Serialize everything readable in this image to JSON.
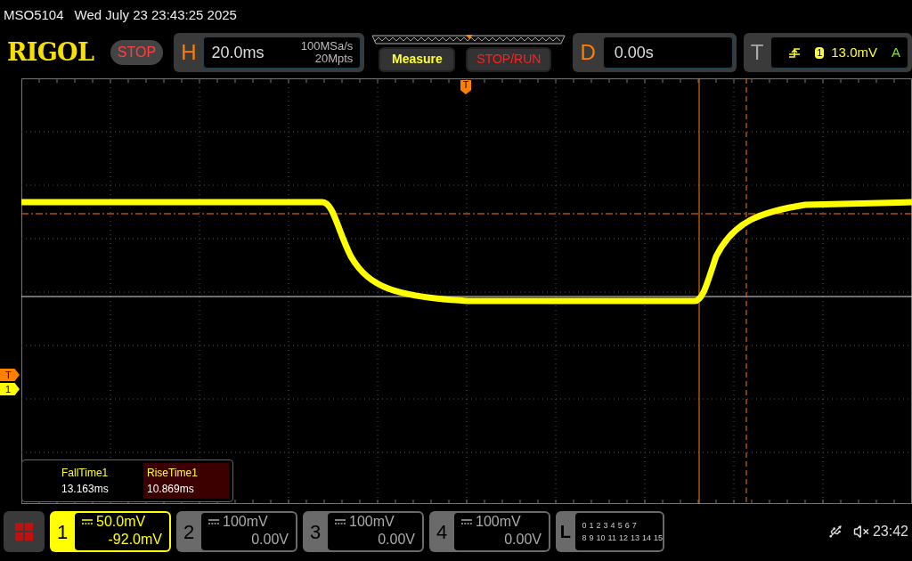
{
  "status_line": {
    "model": "MSO5104",
    "datetime": "Wed July 23 23:43:25 2025"
  },
  "header": {
    "logo": "RIGOL",
    "run_state": "STOP",
    "horizontal": {
      "label": "H",
      "timebase": "20.0ms",
      "sample_rate": "100MSa/s",
      "memory_depth": "20Mpts"
    },
    "buttons": [
      {
        "label": "Measure",
        "kind": "measure"
      },
      {
        "label": "STOP/RUN",
        "kind": "run"
      }
    ],
    "delay": {
      "label": "D",
      "value": "0.00s"
    },
    "trigger": {
      "label": "T",
      "source": "1",
      "level": "13.0mV",
      "mode": "A"
    }
  },
  "display": {
    "trigger_marker": "T",
    "level_markers": [
      {
        "label": "T",
        "color": "#ff7f00"
      },
      {
        "label": "1",
        "color": "#ffff00"
      }
    ],
    "measurements": [
      {
        "name": "FallTime1",
        "value": "13.163ms",
        "selected": false
      },
      {
        "name": "RiseTime1",
        "value": "10.869ms",
        "selected": true
      }
    ]
  },
  "channels": [
    {
      "number": "1",
      "scale": "50.0mV",
      "offset": "-92.0mV",
      "selected": true
    },
    {
      "number": "2",
      "scale": "100mV",
      "offset": "0.00V",
      "selected": false
    },
    {
      "number": "3",
      "scale": "100mV",
      "offset": "0.00V",
      "selected": false
    },
    {
      "number": "4",
      "scale": "100mV",
      "offset": "0.00V",
      "selected": false
    }
  ],
  "logic": {
    "label": "L",
    "bits_row_1": [
      "0",
      "1",
      "2",
      "3",
      "4",
      "5",
      "6",
      "7"
    ],
    "bits_row_2": [
      "8",
      "9",
      "10",
      "11",
      "12",
      "13",
      "14",
      "15"
    ]
  },
  "status_icons": {
    "time": "23:42"
  }
}
